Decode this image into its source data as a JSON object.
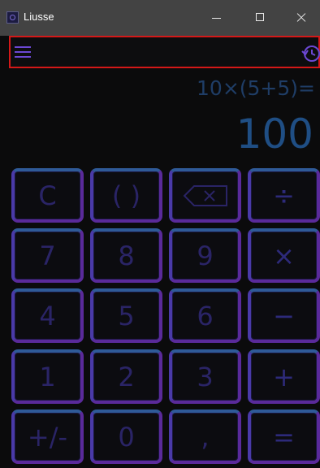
{
  "window": {
    "title": "Liusse"
  },
  "appbar": {
    "menu_icon": "hamburger-menu-icon",
    "history_icon": "history-icon"
  },
  "display": {
    "expression": "10×(5+5)=",
    "result": "100"
  },
  "keypad": {
    "rows": [
      [
        "C",
        "( )",
        "",
        "÷"
      ],
      [
        "7",
        "8",
        "9",
        "×"
      ],
      [
        "4",
        "5",
        "6",
        "−"
      ],
      [
        "1",
        "2",
        "3",
        "+"
      ],
      [
        "+/-",
        "0",
        ",",
        "="
      ]
    ],
    "backspace_icon": "backspace-icon"
  },
  "colors": {
    "titlebar": "#434343",
    "highlight": "#d41818",
    "accent": "#6c48d4",
    "display_text": "#1f4e84",
    "key_border": "#5a2a9a"
  }
}
